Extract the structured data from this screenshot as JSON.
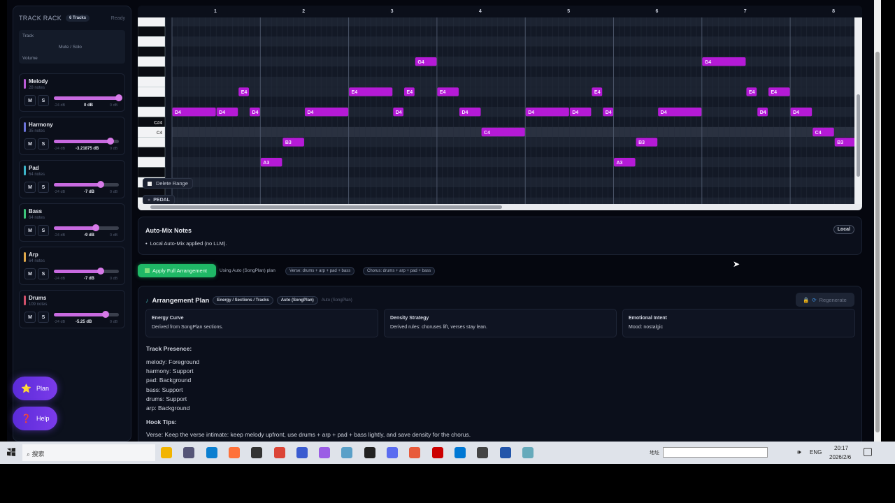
{
  "rack": {
    "title": "TRACK RACK",
    "count": "6 Tracks",
    "status": "Ready",
    "legend": {
      "track": "Track",
      "mute_solo": "Mute / Solo",
      "volume": "Volume"
    },
    "min_label": "-24 dB",
    "max_label": "0 dB",
    "mute": "M",
    "solo": "S",
    "tracks": [
      {
        "name": "Melody",
        "notes": "28 notes",
        "db": "0 dB",
        "level": 1.0,
        "color": "#b95ad6"
      },
      {
        "name": "Harmony",
        "notes": "35 notes",
        "db": "-3.21875 dB",
        "level": 0.866,
        "color": "#6b72d8"
      },
      {
        "name": "Pad",
        "notes": "64 notes",
        "db": "-7 dB",
        "level": 0.708,
        "color": "#3cb4c8"
      },
      {
        "name": "Bass",
        "notes": "64 notes",
        "db": "-9 dB",
        "level": 0.625,
        "color": "#3cc47a"
      },
      {
        "name": "Arp",
        "notes": "64 notes",
        "db": "-7 dB",
        "level": 0.708,
        "color": "#e0a84a"
      },
      {
        "name": "Drums",
        "notes": "109 notes",
        "db": "-5.25 dB",
        "level": 0.781,
        "color": "#d0506a"
      }
    ]
  },
  "fabs": {
    "plan": "Plan",
    "help": "Help"
  },
  "roll": {
    "bars": [
      "1",
      "2",
      "3",
      "4",
      "5",
      "6",
      "7",
      "8"
    ],
    "key_labels": {
      "cs4": "C#4",
      "c4": "C4"
    },
    "delete_range": "Delete Range",
    "pedal": "PEDAL",
    "note_color": "#b51ad6",
    "notes": [
      [
        "D4",
        0,
        2
      ],
      [
        "D4",
        2,
        1
      ],
      [
        "E4",
        3,
        0.5
      ],
      [
        "D4",
        3.5,
        0.5
      ],
      [
        "A3",
        4,
        1
      ],
      [
        "B3",
        5,
        1
      ],
      [
        "D4",
        6,
        2
      ],
      [
        "E4",
        8,
        2
      ],
      [
        "D4",
        10,
        0.5
      ],
      [
        "E4",
        10.5,
        0.5
      ],
      [
        "G4",
        11,
        1
      ],
      [
        "E4",
        12,
        1
      ],
      [
        "D4",
        13,
        1
      ],
      [
        "C4",
        14,
        2
      ],
      [
        "D4",
        16,
        2
      ],
      [
        "D4",
        18,
        1
      ],
      [
        "E4",
        19,
        0.5
      ],
      [
        "D4",
        19.5,
        0.5
      ],
      [
        "A3",
        20,
        1
      ],
      [
        "B3",
        21,
        1
      ],
      [
        "D4",
        22,
        2
      ],
      [
        "G4",
        24,
        2
      ],
      [
        "E4",
        26,
        0.5
      ],
      [
        "D4",
        26.5,
        0.5
      ],
      [
        "E4",
        27,
        1
      ],
      [
        "D4",
        28,
        1
      ],
      [
        "C4",
        29,
        1
      ],
      [
        "B3",
        30,
        1.3
      ]
    ]
  },
  "automix": {
    "title": "Auto-Mix Notes",
    "badge": "Local",
    "items": [
      "Local Auto-Mix applied (no LLM)."
    ]
  },
  "apply": {
    "button": "Apply Full Arrangement",
    "using": "Using Auto (SongPlan) plan",
    "verse": "Verse: drums + arp + pad + bass",
    "chorus": "Chorus: drums + arp + pad + bass"
  },
  "plan": {
    "title": "Arrangement Plan",
    "tag1": "Energy / Sections / Tracks",
    "tag2": "Auto (SongPlan)",
    "source": "Auto (SongPlan)",
    "regenerate": "Regenerate",
    "energy": {
      "title": "Energy Curve",
      "text": "Derived from SongPlan sections."
    },
    "density": {
      "title": "Density Strategy",
      "text": "Derived rules: choruses lift, verses stay lean."
    },
    "emotion": {
      "title": "Emotional Intent",
      "text": "Mood: nostalgic"
    },
    "presence_title": "Track Presence:",
    "presence": [
      "melody: Foreground",
      "harmony: Support",
      "pad: Background",
      "bass: Support",
      "drums: Support",
      "arp: Background"
    ],
    "hook_title": "Hook Tips:",
    "hook": "Verse: Keep the verse intimate: keep melody upfront, use drums + arp + pad + bass lightly, and save density for the chorus."
  },
  "taskbar": {
    "search": "搜索",
    "address_label": "地址",
    "lang": "ENG",
    "time": "20:17",
    "date": "2026/2/6"
  }
}
